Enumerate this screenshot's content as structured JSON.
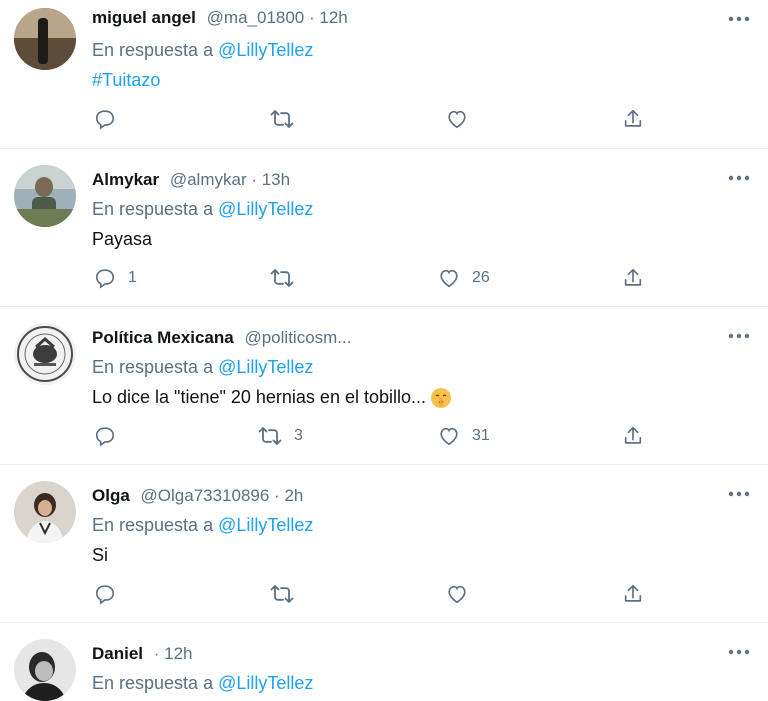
{
  "tweets": [
    {
      "name": "miguel angel",
      "handle": "@ma_01800 · 12h",
      "reply_prefix": "En respuesta a",
      "reply_to": "@LillyTellez",
      "text": "#Tuitazo",
      "text_is_link": true,
      "replies": "",
      "retweets": "",
      "likes": ""
    },
    {
      "name": "Almykar",
      "handle": "@almykar · 13h",
      "reply_prefix": "En respuesta a",
      "reply_to": "@LillyTellez",
      "text": "Payasa",
      "replies": "1",
      "retweets": "",
      "likes": "26"
    },
    {
      "name": "Política Mexicana",
      "handle": "@politicosm...",
      "reply_prefix": "En respuesta a",
      "reply_to": "@LillyTellez",
      "text": "Lo dice la \"tiene\" 20 hernias en el tobillo...",
      "emoji": "shushing-face-emoji",
      "replies": "",
      "retweets": "3",
      "likes": "31"
    },
    {
      "name": "Olga",
      "handle": "@Olga73310896 · 2h",
      "reply_prefix": "En respuesta a",
      "reply_to": "@LillyTellez",
      "text": "Si",
      "replies": "",
      "retweets": "",
      "likes": ""
    },
    {
      "name": "Daniel",
      "handle": "· 12h",
      "reply_prefix": "En respuesta a",
      "reply_to": "@LillyTellez",
      "text": ""
    }
  ],
  "colors": {
    "accent": "#1da1f2",
    "secondary_text": "#5b7083",
    "divider": "#e6ecf0"
  },
  "icons": {
    "reply": "reply-icon",
    "retweet": "retweet-icon",
    "like": "heart-icon",
    "share": "share-icon",
    "more": "more-icon"
  }
}
